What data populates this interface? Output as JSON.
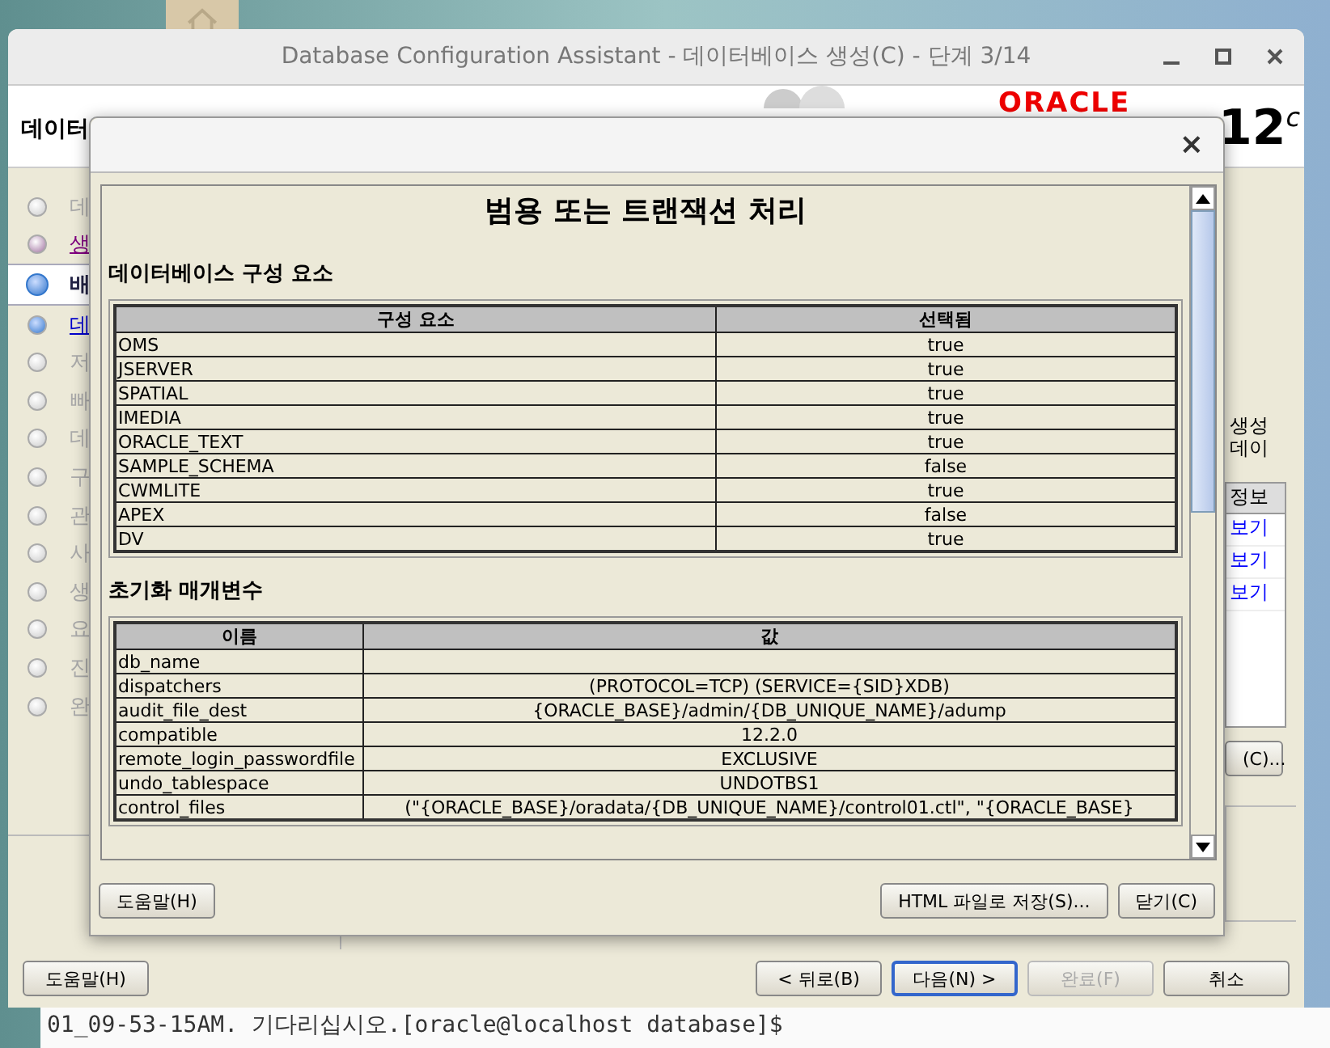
{
  "window": {
    "title": "Database Configuration Assistant - 데이터베이스 생성(C) - 단계 3/14"
  },
  "header": {
    "label": "데이터",
    "logo_brand": "ORACLE",
    "logo_version": "12$^{c}$"
  },
  "steps": [
    {
      "label": "데",
      "kind": "done"
    },
    {
      "label": "생",
      "kind": "visited"
    },
    {
      "label": "배",
      "kind": "current"
    },
    {
      "label": "데",
      "kind": "link"
    },
    {
      "label": "저",
      "kind": "pending"
    },
    {
      "label": "빠",
      "kind": "pending"
    },
    {
      "label": "데",
      "kind": "pending"
    },
    {
      "label": "구",
      "kind": "pending"
    },
    {
      "label": "관",
      "kind": "pending"
    },
    {
      "label": "사",
      "kind": "pending"
    },
    {
      "label": "생",
      "kind": "pending"
    },
    {
      "label": "요",
      "kind": "pending"
    },
    {
      "label": "진",
      "kind": "pending"
    },
    {
      "label": "완",
      "kind": "pending"
    }
  ],
  "content": {
    "description": [
      "생성",
      "데이"
    ],
    "table_header": "정보",
    "links": [
      "보기",
      "보기",
      "보기"
    ],
    "button": "(C)..."
  },
  "buttons": [
    {
      "label": "도움말(H)",
      "kind": "left",
      "disabled": false,
      "default": false
    },
    {
      "label": "< 뒤로(B)",
      "kind": "right",
      "disabled": false,
      "default": false
    },
    {
      "label": "다음(N) >",
      "kind": "right",
      "disabled": false,
      "default": true
    },
    {
      "label": "완료(F)",
      "kind": "right",
      "disabled": true,
      "default": false
    },
    {
      "label": "취소",
      "kind": "right",
      "disabled": false,
      "default": false
    }
  ],
  "terminal": {
    "line": "01_09-53-15AM. 기다리십시오.[oracle@localhost database]$"
  },
  "dialog": {
    "close": "×",
    "heading": "범용 또는 트랜잭션 처리",
    "sections": [
      {
        "title": "데이터베이스 구성 요소",
        "columns": [
          "구성 요소",
          "선택됨"
        ],
        "rows": [
          {
            "name": "OMS",
            "value": "true"
          },
          {
            "name": "JSERVER",
            "value": "true"
          },
          {
            "name": "SPATIAL",
            "value": "true"
          },
          {
            "name": "IMEDIA",
            "value": "true"
          },
          {
            "name": "ORACLE_TEXT",
            "value": "true"
          },
          {
            "name": "SAMPLE_SCHEMA",
            "value": "false"
          },
          {
            "name": "CWMLITE",
            "value": "true"
          },
          {
            "name": "APEX",
            "value": "false"
          },
          {
            "name": "DV",
            "value": "true"
          }
        ]
      },
      {
        "title": "초기화 매개변수",
        "columns": [
          "이름",
          "값"
        ],
        "rows": [
          {
            "name": "db_name"
          },
          {
            "name": "dispatchers",
            "value": "(PROTOCOL=TCP) (SERVICE={SID}XDB)"
          },
          {
            "name": "audit_file_dest",
            "value": "{ORACLE_BASE}/admin/{DB_UNIQUE_NAME}/adump"
          },
          {
            "name": "compatible",
            "value": "12.2.0"
          },
          {
            "name": "remote_login_passwordfile",
            "value": "EXCLUSIVE"
          },
          {
            "name": "undo_tablespace",
            "value": "UNDOTBS1"
          },
          {
            "name": "control_files",
            "value": "(\"{ORACLE_BASE}/oradata/{DB_UNIQUE_NAME}/control01.ctl\", \"{ORACLE_BASE}"
          }
        ]
      }
    ],
    "buttons": [
      {
        "label": "도움말(H)",
        "kind": "left"
      },
      {
        "label": "HTML 파일로 저장(S)...",
        "kind": "right"
      },
      {
        "label": "닫기(C)",
        "kind": "right"
      }
    ]
  }
}
